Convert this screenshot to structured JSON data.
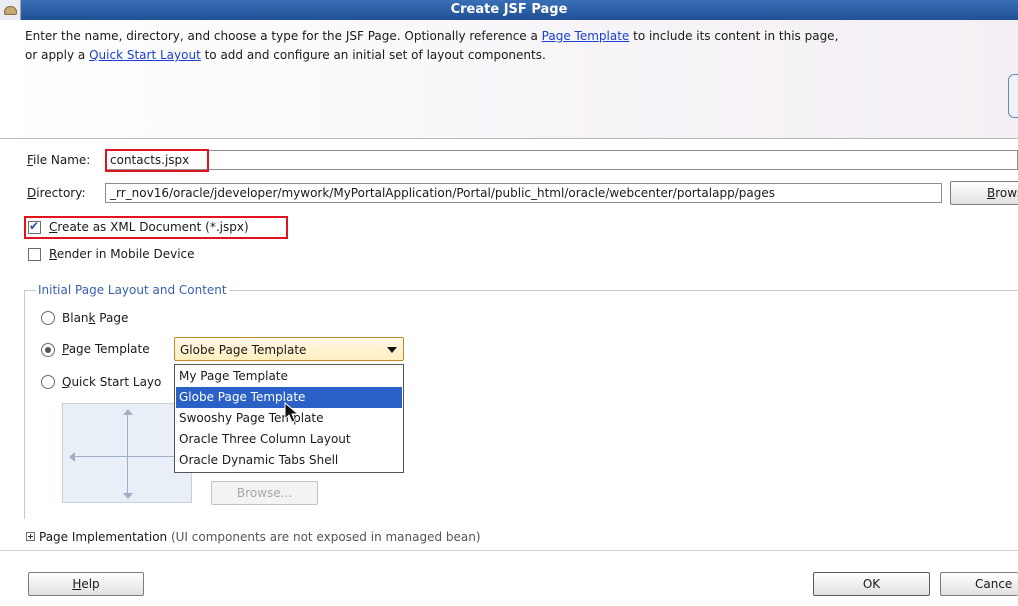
{
  "window": {
    "title": "Create JSF Page"
  },
  "header": {
    "desc_part1": "Enter the name, directory, and choose a type for the JSF Page. Optionally reference a ",
    "link_page_template": "Page Template",
    "desc_part2": " to include its content in this page,",
    "desc_part3": "or apply a ",
    "link_quick_start": "Quick Start Layout",
    "desc_part4": " to add and configure an initial set of layout components."
  },
  "form": {
    "file_name_label_m": "F",
    "file_name_label_rest": "ile Name:",
    "file_name_value": "contacts.jspx",
    "directory_label_m": "D",
    "directory_label_rest": "irectory:",
    "directory_value": "_rr_nov16/oracle/jdeveloper/mywork/MyPortalApplication/Portal/public_html/oracle/webcenter/portalapp/pages",
    "browse_label_m": "B",
    "browse_label_rest": "rowse",
    "xml_checkbox_m": "C",
    "xml_checkbox_rest": "reate as XML Document (*.jspx)",
    "xml_checked": true,
    "mobile_checkbox_m": "R",
    "mobile_checkbox_rest": "ender in Mobile Device",
    "mobile_checked": false
  },
  "layout_group": {
    "title": "Initial Page Layout and Content",
    "blank_page_a": "Blan",
    "blank_page_m": "k",
    "blank_page_b": " Page",
    "page_template_m": "P",
    "page_template_rest": "age Template",
    "quick_start_m": "Q",
    "quick_start_rest": "uick Start Layo",
    "selected_option": "page_template",
    "combo_value": "Globe Page Template",
    "dropdown_items": [
      "My Page Template",
      "Globe Page Template",
      "Swooshy Page Template",
      "Oracle Three Column Layout",
      "Oracle Dynamic Tabs Shell"
    ],
    "dropdown_selected_index": 1,
    "browse_disabled_label": "Browse..."
  },
  "implementation": {
    "label": "Page Implementation",
    "note": " (UI components are not exposed in managed bean)"
  },
  "footer": {
    "help_m": "H",
    "help_rest": "elp",
    "ok_label": "OK",
    "cancel_label": "Cance"
  },
  "colors": {
    "titlebar": "#2b5ca5",
    "highlight": "#e0141e",
    "selection": "#2b61c6",
    "link": "#1a3fd0"
  }
}
